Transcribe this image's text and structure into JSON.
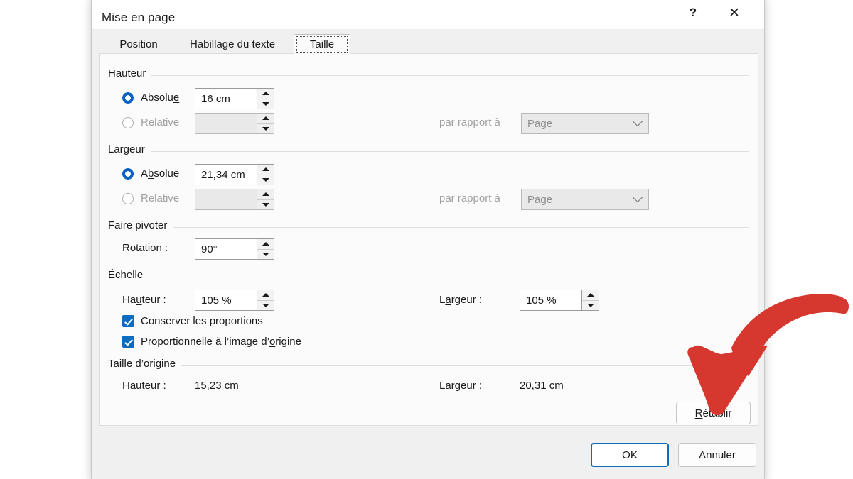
{
  "dialog": {
    "title": "Mise en page",
    "help_label": "?",
    "close_label": "✕",
    "tabs": [
      {
        "label": "Position",
        "selected": false
      },
      {
        "label": "Habillage du texte",
        "selected": false
      },
      {
        "label": "Taille",
        "selected": true
      }
    ]
  },
  "groups": {
    "hauteur": {
      "title": "Hauteur",
      "absolute_label_pre": "Absolu",
      "absolute_label_accel": "e",
      "absolute_label_post": "",
      "absolute_value": "16 cm",
      "absolute_selected": true,
      "relative_label": "Relative",
      "relative_value": "",
      "relative_selected": false,
      "relative_to_label": "par rapport à",
      "relative_to_value": "Page"
    },
    "largeur": {
      "title": "Largeur",
      "absolute_label_pre": "A",
      "absolute_label_accel": "b",
      "absolute_label_post": "solue",
      "absolute_value": "21,34 cm",
      "absolute_selected": true,
      "relative_label": "Relative",
      "relative_value": "",
      "relative_selected": false,
      "relative_to_label": "par rapport à",
      "relative_to_value": "Page"
    },
    "rotation": {
      "title": "Faire pivoter",
      "label_pre": "Rotatio",
      "label_accel": "n",
      "label_post": " :",
      "value": "90°"
    },
    "echelle": {
      "title": "Échelle",
      "hauteur_label_pre": "Ha",
      "hauteur_label_accel": "u",
      "hauteur_label_post": "teur :",
      "hauteur_value": "105 %",
      "largeur_label_pre": "L",
      "largeur_label_accel": "a",
      "largeur_label_post": "rgeur :",
      "largeur_value": "105 %",
      "check_proportions_pre": "",
      "check_proportions_accel": "C",
      "check_proportions_post": "onserver les proportions",
      "check_proportions_checked": true,
      "check_original_pre": "Proportionnelle à l’image d’",
      "check_original_accel": "o",
      "check_original_post": "rigine",
      "check_original_checked": true
    },
    "origine": {
      "title": "Taille d’origine",
      "hauteur_label": "Hauteur :",
      "hauteur_value": "15,23 cm",
      "largeur_label": "Largeur :",
      "largeur_value": "20,31 cm",
      "reset_button_pre": "",
      "reset_button_accel": "R",
      "reset_button_post": "établir"
    }
  },
  "footer": {
    "ok_label": "OK",
    "cancel_label": "Annuler"
  },
  "annotation": {
    "arrow_color": "#d6372e",
    "arrow_name": "red-curved-arrow-pointing-to-retablir"
  },
  "colors": {
    "accent": "#0f6cbd",
    "radio_blue": "#0b62c4",
    "dialog_body": "#f0f0f0",
    "panel_bg": "#fbfbfb",
    "text": "#1a1a1a",
    "disabled_text": "#a0a0a0",
    "arrow_red": "#d6372e"
  }
}
